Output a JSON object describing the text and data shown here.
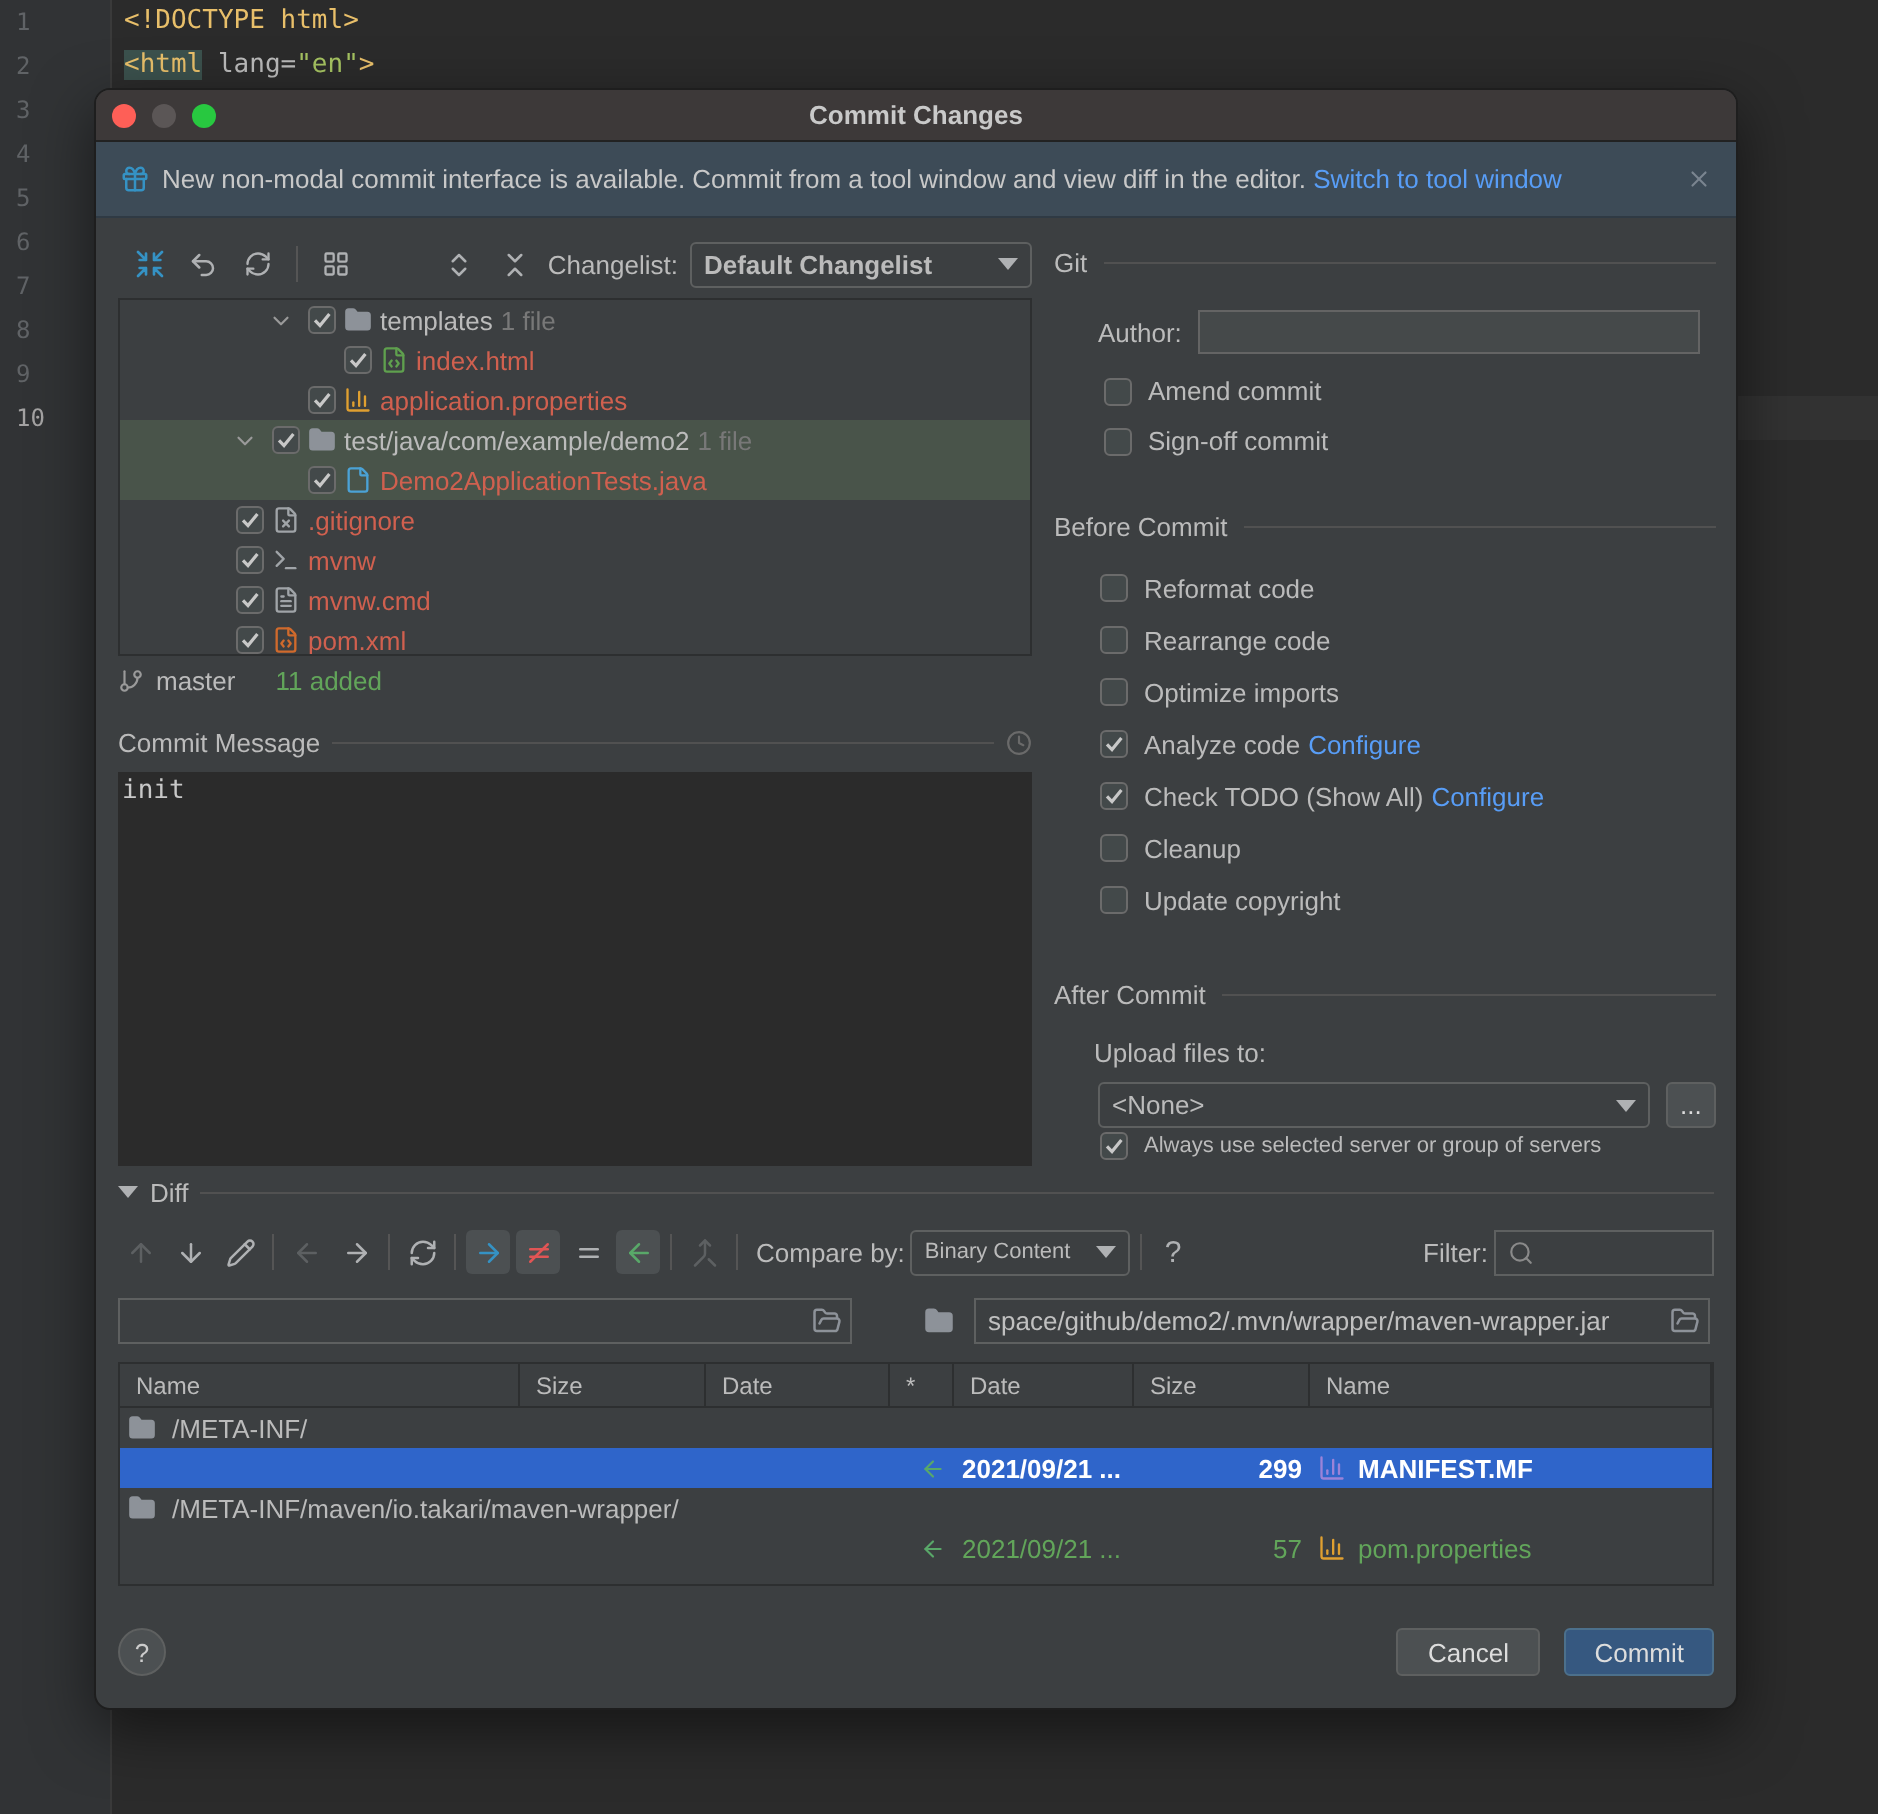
{
  "editor": {
    "lines": [
      {
        "number": "1",
        "current": false,
        "tokens": [
          {
            "text": "<!DOCTYPE html>",
            "kind": "tag",
            "highlight": false
          }
        ]
      },
      {
        "number": "2",
        "current": false,
        "tokens": [
          {
            "text": "<html",
            "kind": "tag",
            "highlight": true
          },
          {
            "text": " lang=",
            "kind": "attr",
            "highlight": false
          },
          {
            "text": "\"en\"",
            "kind": "string",
            "highlight": false
          },
          {
            "text": ">",
            "kind": "tag",
            "highlight": false
          }
        ]
      },
      {
        "number": "3",
        "current": false
      },
      {
        "number": "4",
        "current": false
      },
      {
        "number": "5",
        "current": false
      },
      {
        "number": "6",
        "current": false
      },
      {
        "number": "7",
        "current": false
      },
      {
        "number": "8",
        "current": false
      },
      {
        "number": "9",
        "current": false
      },
      {
        "number": "10",
        "current": true
      }
    ]
  },
  "dialog": {
    "title": "Commit Changes",
    "banner": {
      "text": "New non-modal commit interface is available. Commit from a tool window and view diff in the editor.",
      "link": "Switch to tool window"
    },
    "changelist": {
      "label": "Changelist:",
      "value": "Default Changelist"
    },
    "tree": [
      {
        "children": [
          {
            "children": [
              {
                "label": "templates",
                "kind": "folder",
                "count": "1 file",
                "checked": true,
                "expanded": true,
                "selected": false,
                "children": [
                  {
                    "label": "index.html",
                    "kind": "html",
                    "checked": true,
                    "selected": false
                  }
                ]
              },
              {
                "label": "application.properties",
                "kind": "properties",
                "checked": true,
                "selected": false
              }
            ]
          },
          {
            "label": "test/java/com/example/demo2",
            "kind": "folder",
            "count": "1 file",
            "checked": true,
            "expanded": true,
            "selected": true,
            "children": [
              {
                "label": "Demo2ApplicationTests.java",
                "kind": "java",
                "checked": true,
                "selected": true
              }
            ]
          }
        ]
      },
      {
        "label": ".gitignore",
        "kind": "ignore",
        "checked": true,
        "selected": false
      },
      {
        "label": "mvnw",
        "kind": "shell",
        "checked": true,
        "selected": false
      },
      {
        "label": "mvnw.cmd",
        "kind": "text",
        "checked": true,
        "selected": false
      },
      {
        "label": "pom.xml",
        "kind": "xml",
        "checked": true,
        "selected": false
      }
    ],
    "branch": {
      "name": "master",
      "summary": "11 added"
    },
    "commit_message": {
      "label": "Commit Message",
      "value": "init"
    },
    "git": {
      "title": "Git",
      "author_label": "Author:",
      "options": [
        {
          "label": "Amend commit",
          "checked": false
        },
        {
          "label": "Sign-off commit",
          "checked": false
        }
      ]
    },
    "before_commit": {
      "title": "Before Commit",
      "options": [
        {
          "label": "Reformat code",
          "checked": false
        },
        {
          "label": "Rearrange code",
          "checked": false
        },
        {
          "label": "Optimize imports",
          "checked": false
        },
        {
          "label": "Analyze code",
          "checked": true,
          "link": "Configure"
        },
        {
          "label": "Check TODO (Show All)",
          "checked": true,
          "link": "Configure"
        },
        {
          "label": "Cleanup",
          "checked": false
        },
        {
          "label": "Update copyright",
          "checked": false
        }
      ]
    },
    "after_commit": {
      "title": "After Commit",
      "upload_label": "Upload files to:",
      "upload_value": "<None>",
      "browse": "...",
      "always": {
        "label": "Always use selected server or group of servers",
        "checked": true
      }
    },
    "diff": {
      "title": "Diff",
      "expanded": true,
      "tools": [
        {
          "kind": "up",
          "disabled": true,
          "on": false
        },
        {
          "kind": "down",
          "disabled": false,
          "on": false
        },
        {
          "kind": "edit",
          "disabled": false,
          "on": false
        },
        {
          "kind": "sep"
        },
        {
          "kind": "left",
          "disabled": true,
          "on": false
        },
        {
          "kind": "right",
          "disabled": false,
          "on": false
        },
        {
          "kind": "sep"
        },
        {
          "kind": "refresh",
          "disabled": false,
          "on": false
        },
        {
          "kind": "sep"
        },
        {
          "kind": "copy-right",
          "disabled": false,
          "on": true
        },
        {
          "kind": "not-equal",
          "disabled": false,
          "on": true
        },
        {
          "kind": "equal",
          "disabled": false,
          "on": false
        },
        {
          "kind": "copy-left",
          "disabled": false,
          "on": true
        },
        {
          "kind": "sep"
        },
        {
          "kind": "merge",
          "disabled": true,
          "on": false
        },
        {
          "kind": "sep"
        }
      ],
      "compare_label": "Compare by:",
      "compare_value": "Binary Content",
      "help": "?",
      "filter_label": "Filter:",
      "right_path": "space/github/demo2/.mvn/wrapper/maven-wrapper.jar",
      "columns": [
        "Name",
        "Size",
        "Date",
        "*",
        "Date",
        "Size",
        "Name"
      ],
      "rows": [
        {
          "kind": "folder",
          "path": "/META-INF/",
          "selected": false
        },
        {
          "kind": "manifest",
          "date": "2021/09/21 ...",
          "size": "299",
          "name": "MANIFEST.MF",
          "selected": true,
          "color": "#ffffff"
        },
        {
          "kind": "folder",
          "path": "/META-INF/maven/io.takari/maven-wrapper/",
          "selected": false
        },
        {
          "kind": "properties",
          "date": "2021/09/21 ...",
          "size": "57",
          "name": "pom.properties",
          "selected": false,
          "color": "#62a55a"
        }
      ]
    },
    "buttons": [
      {
        "label": "Cancel",
        "primary": false
      },
      {
        "label": "Commit",
        "primary": true
      }
    ],
    "help": "?"
  }
}
